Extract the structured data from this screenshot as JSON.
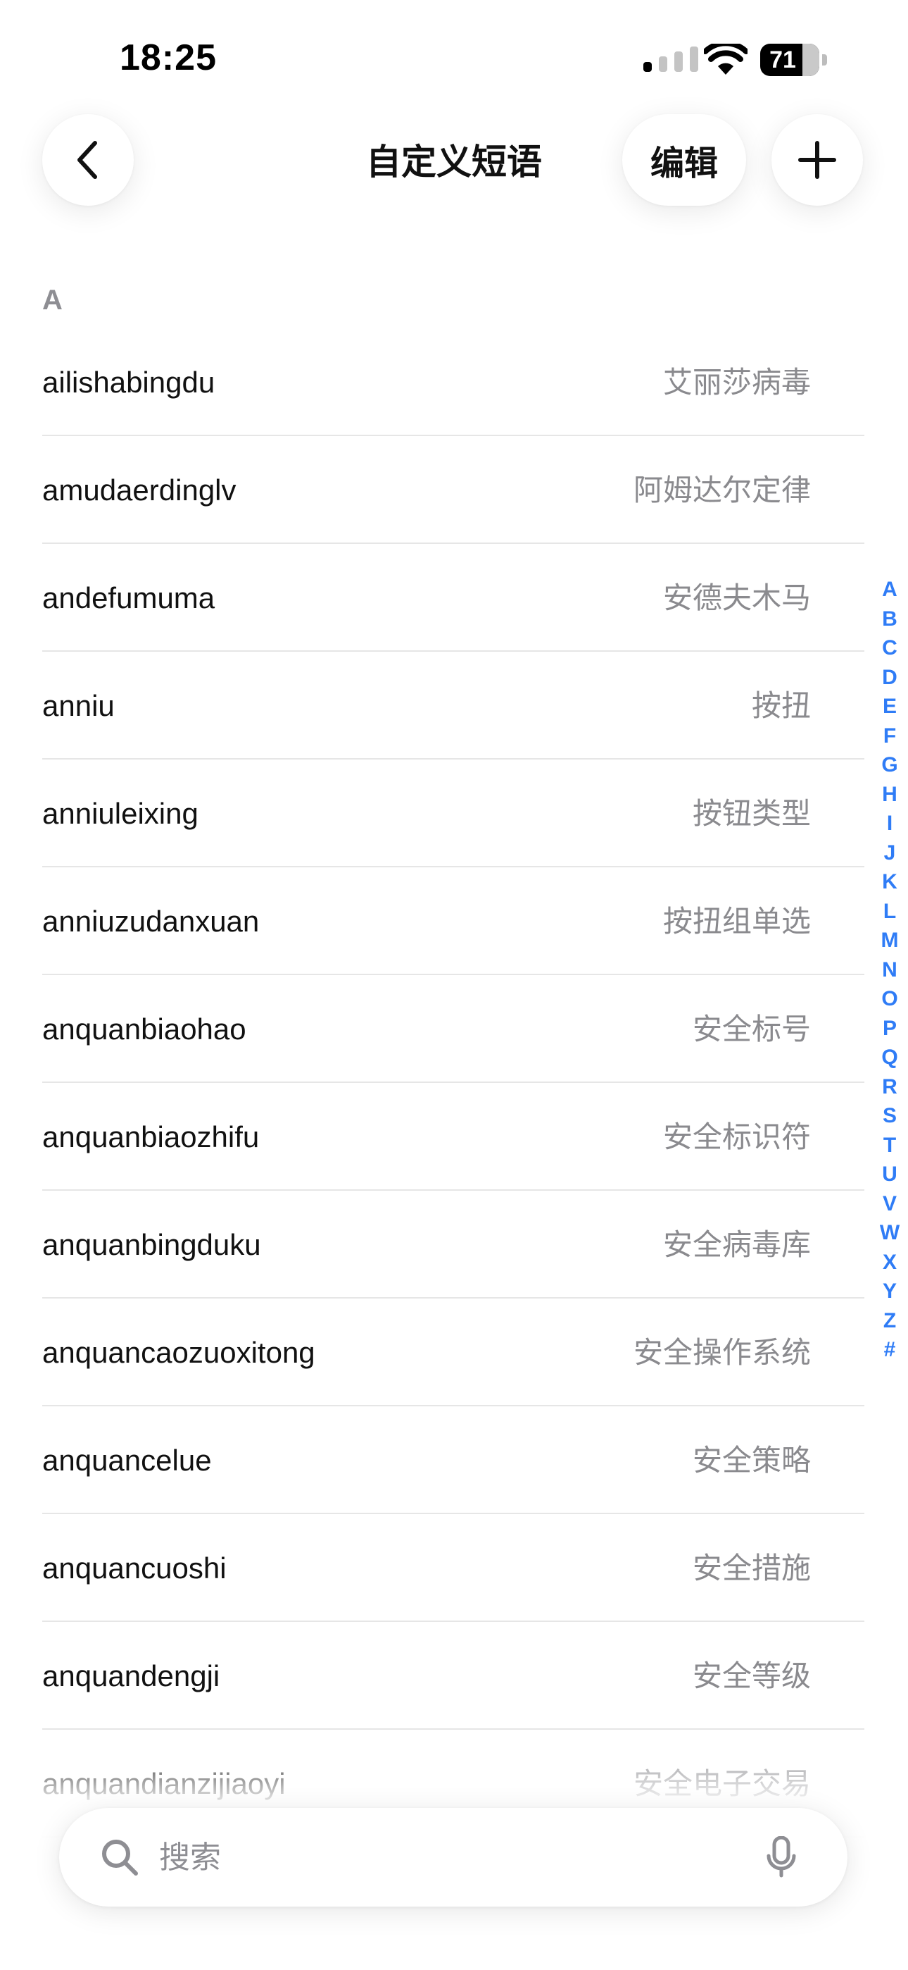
{
  "status_bar": {
    "time": "18:25",
    "battery_level": "71",
    "battery_fraction": 0.71
  },
  "nav": {
    "title": "自定义短语",
    "edit_label": "编辑",
    "back_icon": "chevron-left-icon",
    "add_icon": "plus-icon"
  },
  "section": {
    "header": "A"
  },
  "phrases": [
    {
      "code": "ailishabingdu",
      "text": "艾丽莎病毒"
    },
    {
      "code": "amudaerdinglv",
      "text": "阿姆达尔定律"
    },
    {
      "code": "andefumuma",
      "text": "安德夫木马"
    },
    {
      "code": "anniu",
      "text": "按扭"
    },
    {
      "code": "anniuleixing",
      "text": "按钮类型"
    },
    {
      "code": "anniuzudanxuan",
      "text": "按扭组单选"
    },
    {
      "code": "anquanbiaohao",
      "text": "安全标号"
    },
    {
      "code": "anquanbiaozhifu",
      "text": "安全标识符"
    },
    {
      "code": "anquanbingduku",
      "text": "安全病毒库"
    },
    {
      "code": "anquancaozuoxitong",
      "text": "安全操作系统"
    },
    {
      "code": "anquancelue",
      "text": "安全策略"
    },
    {
      "code": "anquancuoshi",
      "text": "安全措施"
    },
    {
      "code": "anquandengji",
      "text": "安全等级"
    },
    {
      "code": "anquandianzijiaoyi",
      "text": "安全电子交易"
    }
  ],
  "index_letters": [
    "A",
    "B",
    "C",
    "D",
    "E",
    "F",
    "G",
    "H",
    "I",
    "J",
    "K",
    "L",
    "M",
    "N",
    "O",
    "P",
    "Q",
    "R",
    "S",
    "T",
    "U",
    "V",
    "W",
    "X",
    "Y",
    "Z",
    "#"
  ],
  "search": {
    "placeholder": "搜索",
    "value": "",
    "search_icon": "search-icon",
    "mic_icon": "microphone-icon"
  },
  "colors": {
    "accent": "#2f7cf6",
    "secondary_text": "#8a8a8e",
    "divider": "#e6e6e6"
  }
}
